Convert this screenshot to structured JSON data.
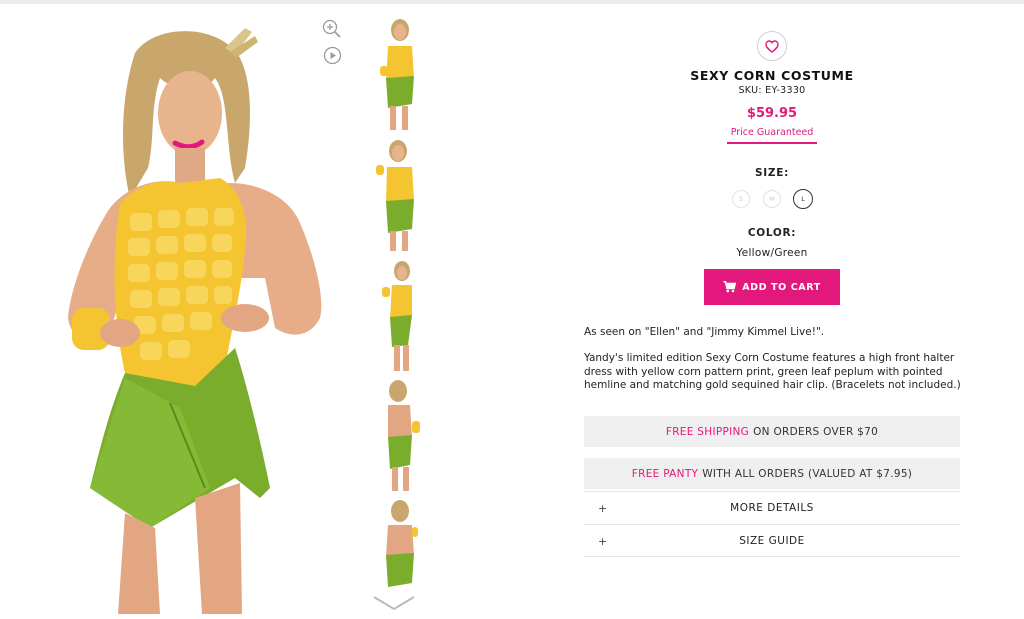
{
  "product": {
    "title": "SEXY CORN COSTUME",
    "sku": "SKU: EY-3330",
    "price": "$59.95",
    "price_guarantee": "Price Guaranteed",
    "size_label": "SIZE:",
    "sizes": [
      "S",
      "M",
      "L"
    ],
    "selected_size": "L",
    "color_label": "COLOR:",
    "color_value": "Yellow/Green",
    "add_to_cart": "ADD TO CART",
    "seen_on": "As seen on \"Ellen\" and \"Jimmy Kimmel Live!\".",
    "description": "Yandy's limited edition Sexy Corn Costume features a high front halter dress with yellow corn pattern print, green leaf peplum with pointed hemline and matching gold sequined hair clip. (Bracelets not included.)"
  },
  "promos": [
    {
      "highlight": "FREE SHIPPING",
      "text": "ON ORDERS OVER $70"
    },
    {
      "highlight": "FREE PANTY",
      "text": "WITH ALL ORDERS (VALUED AT $7.95)"
    }
  ],
  "accordion": [
    {
      "icon": "+",
      "label": "MORE DETAILS"
    },
    {
      "icon": "+",
      "label": "SIZE GUIDE"
    }
  ],
  "colors": {
    "accent": "#e3187d",
    "corn_yellow": "#f5c531",
    "leaf_green": "#7aad2c"
  },
  "icons": [
    "zoom-in-icon",
    "play-icon",
    "heart-icon",
    "cart-icon",
    "chevron-down-icon",
    "plus-icon"
  ]
}
